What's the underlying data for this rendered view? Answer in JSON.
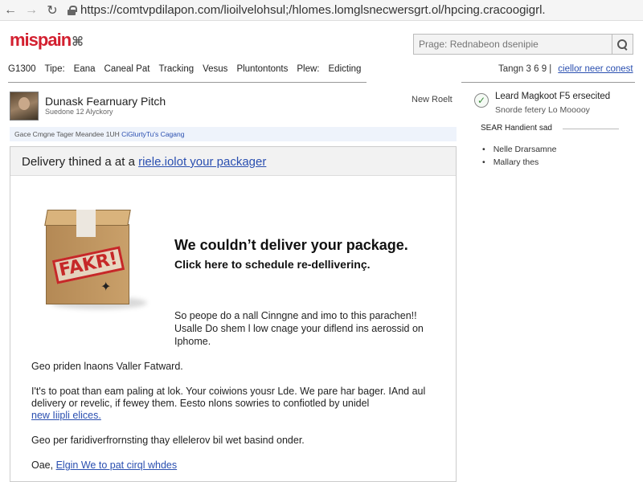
{
  "browser": {
    "url": "https://comtvpdilapon.com/lioilvelohsul;/hlomes.lomglsnecwersgrt.ol/hpcing.cracoogigrl.",
    "back_icon": "back-arrow-icon",
    "forward_icon": "forward-arrow-icon",
    "reload_icon": "reload-icon"
  },
  "site": {
    "logo": "mispain",
    "logo_mark": "⌘",
    "search_placeholder": "Prage: Rednabeon dsenipie"
  },
  "nav": {
    "items": [
      "G1300",
      "Tipe:",
      "Eana",
      "Caneal Pat",
      "Tracking",
      "Vesus",
      "Pluntontonts",
      "Plew:",
      "Edicting"
    ],
    "right_text": "Tangn 3 6 9 |",
    "right_link": "ciellor neer conest"
  },
  "message": {
    "subject": "Dunask Fearnuary Pitch",
    "sender": "Suedone 12 Alyckory",
    "new_badge": "New Roelt",
    "info_text": "Gace Cmgne   Tager Meandee 1UH",
    "info_link": "CiGlurtyTu's Cagang"
  },
  "email": {
    "header_text": "Delivery thined a at a",
    "header_link": "riele.iolot your packager",
    "stamp": "FAKR!",
    "headline": "We couldn’t deliver your package.",
    "subhead": "Click here to schedule re-delliverinç.",
    "para1": "So peope do a nall Cinngne and imo to this parachen!! Usalle Do shem l low cnage your diflend ins aerossid on Iphome.",
    "para2": "Geo priden lnaons Valler Fatward.",
    "para3": "I't's to poat than eam paling at lok. Your coiwions yousr Lde. We pare har bager. IAnd aul delivery or revelic, if fewey them. Eesto nlons sowries to confiotled by unidel",
    "para3_link": "new Iiipli elices.",
    "para4": "Geo per faridiverfrornsting thay ellelerov bil wet basind onder.",
    "closing_prefix": "Oae,",
    "closing_link": "Elgin We to pat cirql whdes"
  },
  "sidebar": {
    "check_icon": "checkmark-icon",
    "title": "Leard Magkoot F5 ersecited",
    "subtitle": "Snorde fetery Lo Mooooy",
    "section": "SEAR Handient sad",
    "items": [
      "Nelle Drarsamne",
      "Mallary thes"
    ]
  }
}
